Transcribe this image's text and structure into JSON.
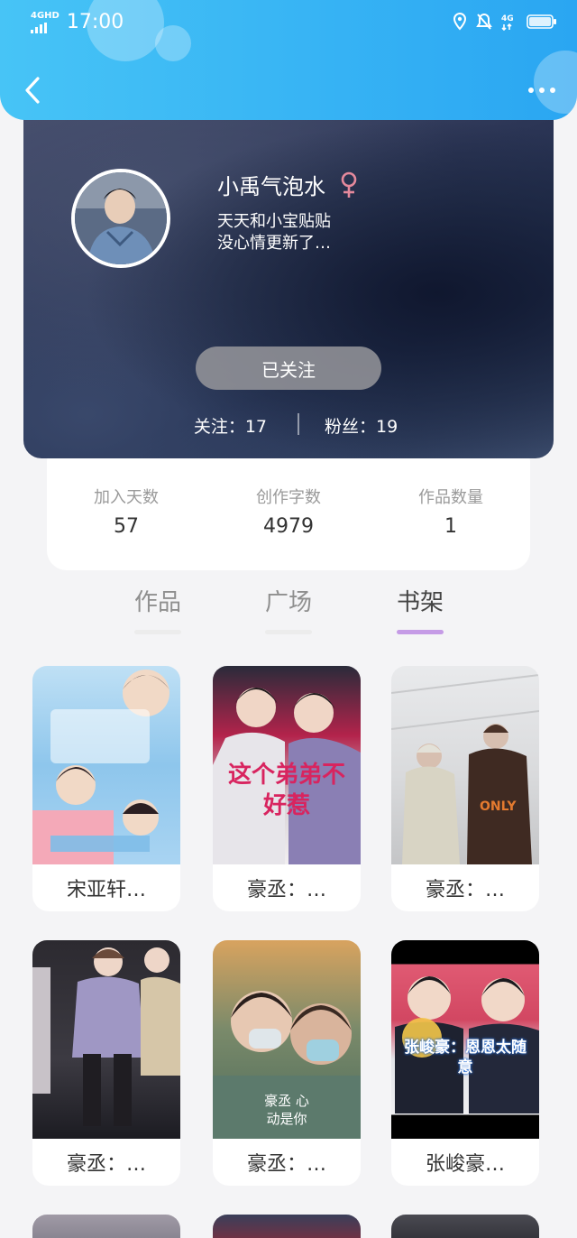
{
  "status_bar": {
    "network": "4GHD",
    "time": "17:00"
  },
  "profile": {
    "nickname": "小禹气泡水",
    "bio_line1": "天天和小宝贴贴",
    "bio_line2": "没心情更新了…",
    "follow_button": "已关注",
    "following_label": "关注：17",
    "fans_label": "粉丝：19",
    "gender_color": "#e5899c"
  },
  "stats": [
    {
      "label": "加入天数",
      "value": "57"
    },
    {
      "label": "创作字数",
      "value": "4979"
    },
    {
      "label": "作品数量",
      "value": "1"
    }
  ],
  "tabs": [
    {
      "label": "作品",
      "active": false
    },
    {
      "label": "广场",
      "active": false
    },
    {
      "label": "书架",
      "active": true
    }
  ],
  "books": [
    {
      "title": "宋亚轩…"
    },
    {
      "title": "豪丞：…",
      "cover_text": "这个弟弟不好惹"
    },
    {
      "title": "豪丞：…"
    },
    {
      "title": "豪丞：…"
    },
    {
      "title": "豪丞：…",
      "cover_text": "豪丞 心动是你"
    },
    {
      "title": "张峻豪…",
      "cover_text": "张峻豪：恩恩太随意"
    }
  ],
  "colors": {
    "header_start": "#47c4f6",
    "header_end": "#2aa6f2",
    "tab_active_bar": "#c59be6"
  }
}
